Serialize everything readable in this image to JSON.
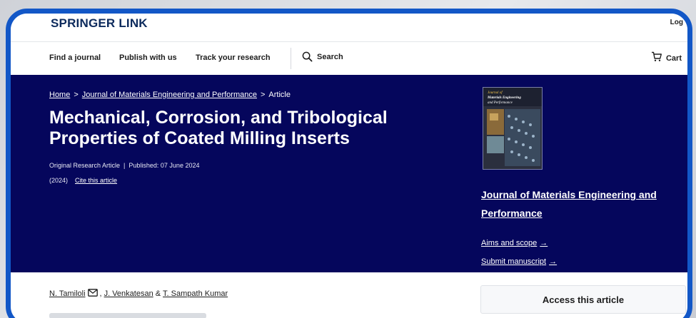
{
  "brand": {
    "name": "SPRINGER LINK",
    "login_label": "Log"
  },
  "nav": {
    "items": [
      "Find a journal",
      "Publish with us",
      "Track your research"
    ],
    "search_label": "Search",
    "cart_label": "Cart"
  },
  "breadcrumb": {
    "home": "Home",
    "journal": "Journal of Materials Engineering and Performance",
    "current": "Article",
    "separator": ">"
  },
  "article": {
    "title": "Mechanical, Corrosion, and Tribological Properties of Coated Milling Inserts",
    "type": "Original Research Article",
    "meta_separator": "|",
    "published": "Published: 07 June 2024",
    "year": "(2024)",
    "cite_label": "Cite this article"
  },
  "journal_panel": {
    "cover_title_line1": "Journal of",
    "cover_title_line2": "Materials Engineering",
    "cover_title_line3": "and Performance",
    "name": "Journal of Materials Engineering and Performance",
    "aims_label": "Aims and scope",
    "submit_label": "Submit manuscript",
    "arrow": "→"
  },
  "authors": {
    "first": "N. Tamiloli",
    "second": "J. Venkatesan",
    "connector": "&",
    "third": "T. Sampath Kumar"
  },
  "access": {
    "label": "Access this article"
  },
  "colors": {
    "hero_bg": "#05065c",
    "frame": "#1257c7",
    "brand": "#0c2a5c"
  },
  "icons": {
    "search": "search-icon",
    "cart": "cart-icon",
    "mail": "mail-icon"
  }
}
